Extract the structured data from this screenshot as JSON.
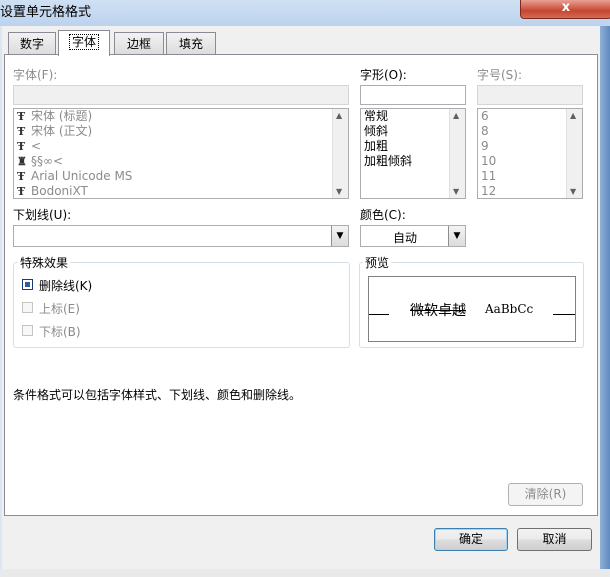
{
  "window": {
    "title": "设置单元格格式",
    "close_symbol": "x"
  },
  "tabs": [
    {
      "label": "数字",
      "active": false
    },
    {
      "label": "字体",
      "active": true
    },
    {
      "label": "边框",
      "active": false
    },
    {
      "label": "填充",
      "active": false
    }
  ],
  "font": {
    "label": "字体(F):",
    "value": "",
    "items": [
      {
        "label": "宋体 (标题)",
        "icon": "truetype-font-icon"
      },
      {
        "label": "宋体 (正文)",
        "icon": "truetype-font-icon"
      },
      {
        "label": "<",
        "icon": "truetype-font-icon"
      },
      {
        "label": "§§∞<",
        "icon": "printer-font-icon"
      },
      {
        "label": "Arial Unicode MS",
        "icon": "truetype-font-icon"
      },
      {
        "label": "BodoniXT",
        "icon": "truetype-font-icon"
      }
    ]
  },
  "style": {
    "label": "字形(O):",
    "value": "",
    "items": [
      "常规",
      "倾斜",
      "加粗",
      "加粗倾斜"
    ]
  },
  "size": {
    "label": "字号(S):",
    "value": "",
    "items": [
      "6",
      "8",
      "9",
      "10",
      "11",
      "12"
    ]
  },
  "underline": {
    "label": "下划线(U):",
    "value": ""
  },
  "color": {
    "label": "颜色(C):",
    "value": "自动"
  },
  "effects": {
    "title": "特殊效果",
    "strikethrough": {
      "label": "删除线(K)",
      "checked": true
    },
    "superscript": {
      "label": "上标(E)",
      "checked": false
    },
    "subscript": {
      "label": "下标(B)",
      "checked": false
    }
  },
  "preview": {
    "title": "预览",
    "sample_cjk": "微软卓越",
    "sample_latin": "AaBbCc"
  },
  "info_text": "条件格式可以包括字体样式、下划线、颜色和删除线。",
  "buttons": {
    "clear": "清除(R)",
    "ok": "确定",
    "cancel": "取消"
  },
  "colors": {
    "accent": "#2d5f9a",
    "disabled_text": "#8b8b8b",
    "close": "#c7462f"
  }
}
